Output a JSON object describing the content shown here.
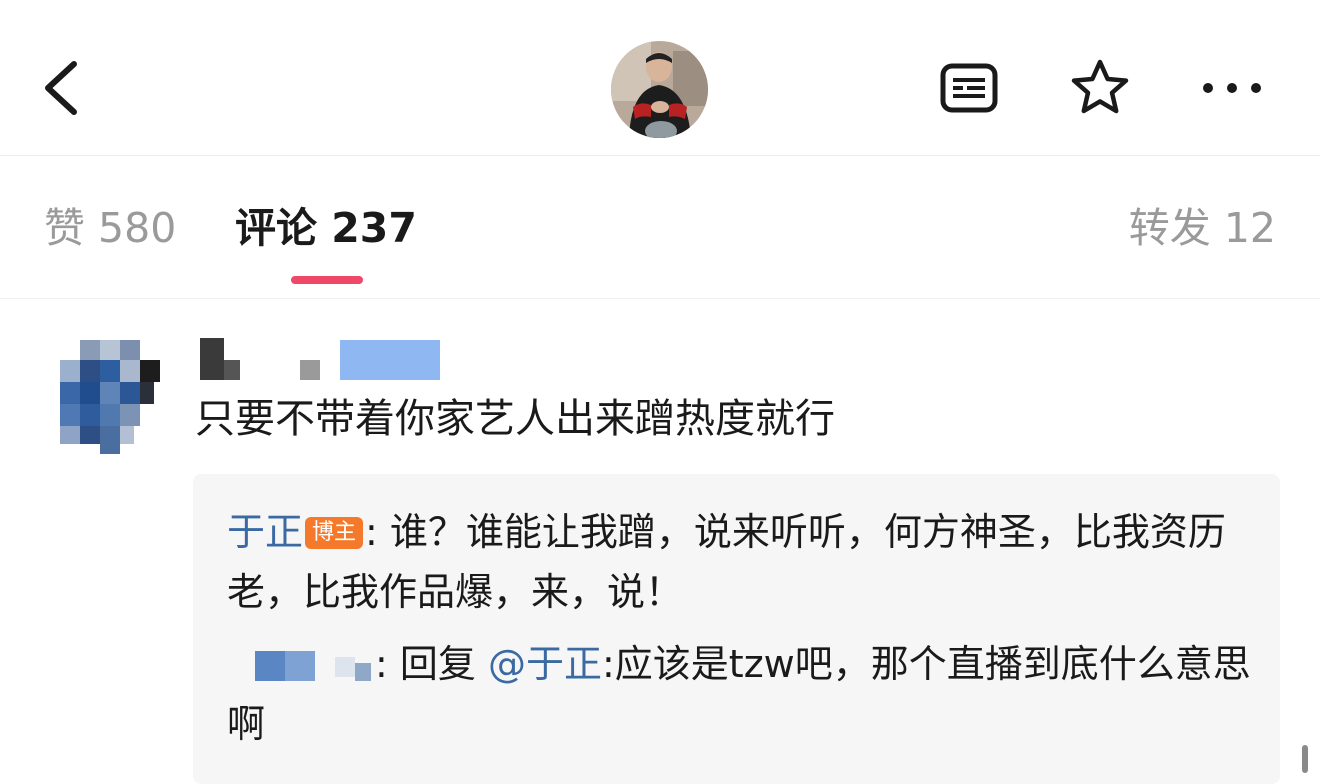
{
  "header": {
    "back_icon": "chevron-left-icon",
    "avatar": "blogger-avatar",
    "icons": [
      "list-view-icon",
      "star-icon",
      "more-icon"
    ]
  },
  "tabs": {
    "like": "赞 580",
    "comment": "评论 237",
    "forward": "转发 12",
    "active": "comment",
    "indicator_color": "#f04868"
  },
  "comment": {
    "text": "只要不带着你家艺人出来蹭热度就行"
  },
  "replies": {
    "first": {
      "user": "于正",
      "badge": "博主",
      "sep": ":",
      "text": " 谁？谁能让我蹭，说来听听，何方神圣，比我资历老，比我作品爆，来，说！"
    },
    "second": {
      "sep": ":",
      "prefix": " 回复 ",
      "mention": "@于正",
      "text": ":应该是tzw吧，那个直播到底什么意思啊"
    }
  },
  "colors": {
    "username": "#3b6aa3",
    "badge": "#f5792a",
    "reply_bg": "#f6f6f6"
  }
}
